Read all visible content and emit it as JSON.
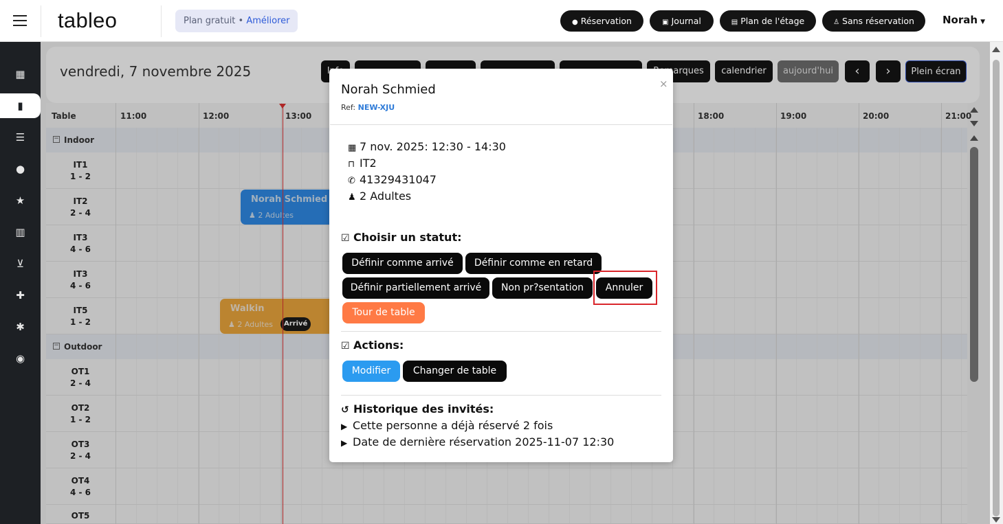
{
  "app": {
    "logo": "tableo",
    "plan_label": "Plan gratuit",
    "plan_sep": " • ",
    "plan_upgrade": "Améliorer",
    "user": "Norah"
  },
  "topnav": [
    {
      "label": "Réservation",
      "icon": "plus-circle-icon"
    },
    {
      "label": "Journal",
      "icon": "calendar-icon"
    },
    {
      "label": "Plan de l'étage",
      "icon": "floorplan-icon"
    },
    {
      "label": "Sans réservation",
      "icon": "walking-icon"
    }
  ],
  "sidebar": [
    {
      "name": "dashboard-icon",
      "glyph": "▦"
    },
    {
      "name": "book-icon",
      "glyph": "▮",
      "active": true
    },
    {
      "name": "list-icon",
      "glyph": "☰"
    },
    {
      "name": "user-icon",
      "glyph": "●"
    },
    {
      "name": "star-icon",
      "glyph": "★"
    },
    {
      "name": "chart-icon",
      "glyph": "▥"
    },
    {
      "name": "cart-icon",
      "glyph": "⊻"
    },
    {
      "name": "puzzle-icon",
      "glyph": "✚"
    },
    {
      "name": "gear-icon",
      "glyph": "✱"
    },
    {
      "name": "headset-icon",
      "glyph": "◉"
    }
  ],
  "schedule": {
    "date": "vendredi, 7 novembre 2025",
    "toolbar": {
      "hidden_1": "Info",
      "hidden_2": "",
      "hidden_3": "",
      "hidden_4": "",
      "hidden_5": "",
      "remarques": "Remarques",
      "calendrier": "calendrier",
      "aujourdhui": "aujourd'hui",
      "prev": "‹",
      "next": "›",
      "fullscreen": "Plein écran"
    },
    "table_header": "Table",
    "hours": [
      "11:00",
      "12:00",
      "13:00",
      "18:00",
      "19:00",
      "20:00",
      "21:00"
    ],
    "sections": [
      {
        "name": "Indoor",
        "tables": [
          {
            "name": "IT1",
            "capacity": "1 - 2"
          },
          {
            "name": "IT2",
            "capacity": "2 - 4"
          },
          {
            "name": "IT3",
            "capacity": "4 - 6"
          },
          {
            "name": "IT3",
            "capacity": "4 - 6"
          },
          {
            "name": "IT5",
            "capacity": "1 - 2"
          }
        ]
      },
      {
        "name": "Outdoor",
        "tables": [
          {
            "name": "OT1",
            "capacity": "2 - 4"
          },
          {
            "name": "OT2",
            "capacity": "1 - 2"
          },
          {
            "name": "OT3",
            "capacity": "2 - 4"
          },
          {
            "name": "OT4",
            "capacity": "4 - 6"
          },
          {
            "name": "OT5",
            "capacity": ""
          }
        ]
      }
    ],
    "reservations": [
      {
        "name": "Norah Schmied",
        "guests": "2 Adultes",
        "color": "#2e86de"
      },
      {
        "name": "Walkin",
        "guests": "2 Adultes",
        "badge": "Arrivé",
        "color": "#e5a23b"
      }
    ]
  },
  "modal": {
    "name": "Norah Schmied",
    "ref_label": "Ref:",
    "ref_code": "NEW-XJU",
    "close": "×",
    "datetime": "7 nov. 2025: 12:30 - 14:30",
    "table": "IT2",
    "phone": "41329431047",
    "guests": "2 Adultes",
    "status_heading": "Choisir un statut:",
    "status_buttons": {
      "arrived": "Définir comme arrivé",
      "late": "Définir comme en retard",
      "partial": "Définir partiellement arrivé",
      "noshow": "Non pr?sentation",
      "cancel": "Annuler",
      "turn": "Tour de table"
    },
    "actions_heading": "Actions:",
    "actions": {
      "modify": "Modifier",
      "change_table": "Changer de table"
    },
    "history_heading": "Historique des invités:",
    "history": [
      "Cette personne a déjà réservé 2 fois",
      "Date de dernière réservation 2025-11-07 12:30"
    ]
  },
  "colors": {
    "accent_blue": "#2e7bd8",
    "orange": "#ff7a45",
    "highlight_red": "#d9252a",
    "sidebar": "#1d2024"
  }
}
